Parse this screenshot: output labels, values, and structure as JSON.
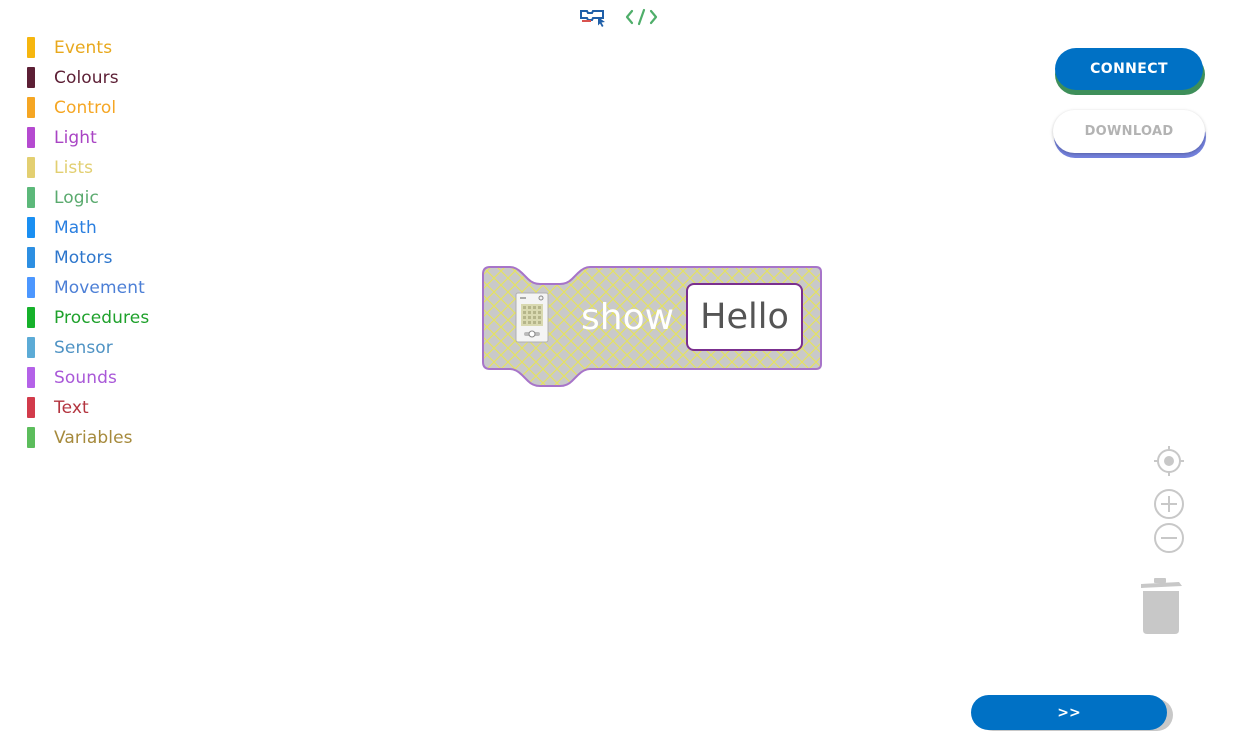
{
  "mode_switch": {
    "blocks_icon": "blocks-mode-icon",
    "code_icon": "code-mode-icon",
    "code_label": "</>"
  },
  "categories": [
    {
      "label": "Events",
      "color": "#f6b60f",
      "text_color": "#e8a81c"
    },
    {
      "label": "Colours",
      "color": "#5c1f35",
      "text_color": "#5c1f35"
    },
    {
      "label": "Control",
      "color": "#f5a623",
      "text_color": "#f5a623"
    },
    {
      "label": "Light",
      "color": "#b54ad0",
      "text_color": "#a944c4"
    },
    {
      "label": "Lists",
      "color": "#e3cf71",
      "text_color": "#e2cf71"
    },
    {
      "label": "Logic",
      "color": "#5cb87a",
      "text_color": "#5aaa6e"
    },
    {
      "label": "Math",
      "color": "#1a8ff2",
      "text_color": "#2a7fe0"
    },
    {
      "label": "Motors",
      "color": "#2d8fe2",
      "text_color": "#2d76cc"
    },
    {
      "label": "Movement",
      "color": "#4c97ff",
      "text_color": "#4c7fd6"
    },
    {
      "label": "Procedures",
      "color": "#16b12b",
      "text_color": "#1ea12b"
    },
    {
      "label": "Sensor",
      "color": "#5cabd6",
      "text_color": "#4f93c4"
    },
    {
      "label": "Sounds",
      "color": "#b462e8",
      "text_color": "#a958d8"
    },
    {
      "label": "Text",
      "color": "#d23b4b",
      "text_color": "#b3343f"
    },
    {
      "label": "Variables",
      "color": "#5cbd5c",
      "text_color": "#a68a3c"
    }
  ],
  "buttons": {
    "connect": "CONNECT",
    "download": "DOWNLOAD",
    "run": ">>"
  },
  "block": {
    "label": "show",
    "input_value": "Hello",
    "device_icon": "microbit-device-icon",
    "fill_color": "#c9c9c9",
    "border_color": "#a774c9",
    "pattern_color": "#e9e64f"
  },
  "workspace_controls": {
    "recenter": "recenter-icon",
    "zoom_in": "zoom-in-icon",
    "zoom_out": "zoom-out-icon",
    "trash": "trash-icon"
  },
  "colors": {
    "primary": "#0071c5",
    "control_gray": "#c8c8c8"
  }
}
